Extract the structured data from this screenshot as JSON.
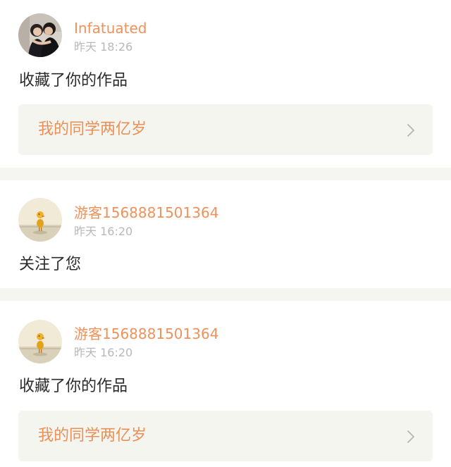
{
  "feed": {
    "items": [
      {
        "user": "Infatuated",
        "time": "昨天 18:26",
        "action": "收藏了你的作品",
        "work_title": "我的同学两亿岁",
        "avatar": "couple-photo-avatar"
      },
      {
        "user": "游客1568881501364",
        "time": "昨天 16:20",
        "action": "关注了您",
        "avatar": "duck-avatar"
      },
      {
        "user": "游客1568881501364",
        "time": "昨天 16:20",
        "action": "收藏了你的作品",
        "work_title": "我的同学两亿岁",
        "avatar": "duck-avatar"
      }
    ]
  },
  "colors": {
    "username": "#f0915b",
    "work_title": "#ea8f57",
    "timestamp": "#b8b8b8",
    "divider": "#f5f5f2",
    "link_background": "#f5f5f0"
  },
  "icons": {
    "chevron": "chevron-right-icon"
  }
}
